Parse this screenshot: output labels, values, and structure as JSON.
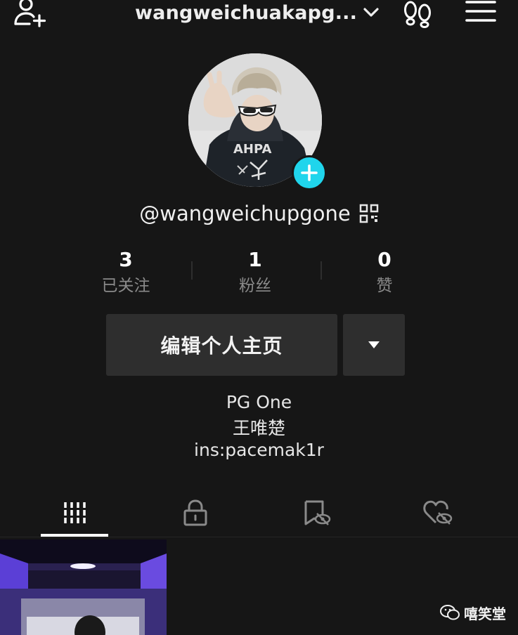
{
  "header": {
    "username": "wangweichuakapg...",
    "icons": {
      "add_user": "add-user-icon",
      "dropdown": "chevron-down-icon",
      "footprint": "footprint-icon",
      "menu": "menu-icon"
    }
  },
  "profile": {
    "handle": "@wangweichupgone",
    "qr_icon": "qr-code-icon",
    "avatar_badge_icon": "plus-icon",
    "accent_color": "#20d5ec"
  },
  "stats": [
    {
      "value": "3",
      "label": "已关注"
    },
    {
      "value": "1",
      "label": "粉丝"
    },
    {
      "value": "0",
      "label": "赞"
    }
  ],
  "actions": {
    "edit_label": "编辑个人主页",
    "more_icon": "caret-down-icon"
  },
  "bio": {
    "line1": "PG One",
    "line2": "王唯楚",
    "line3": "ins:pacemak1r"
  },
  "tabs": [
    {
      "name": "videos",
      "icon": "grid-bars-icon",
      "active": true
    },
    {
      "name": "private",
      "icon": "lock-icon",
      "active": false
    },
    {
      "name": "saved",
      "icon": "bookmark-hidden-icon",
      "active": false
    },
    {
      "name": "liked",
      "icon": "heart-hidden-icon",
      "active": false
    }
  ],
  "watermark": {
    "text": "嘻笑堂",
    "icon": "wechat-icon"
  }
}
